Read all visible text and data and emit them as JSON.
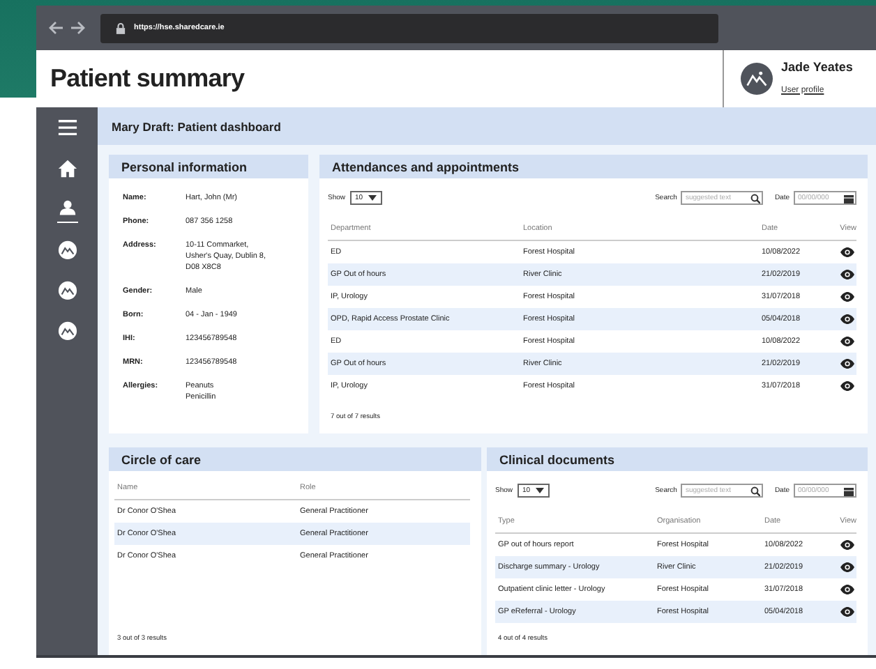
{
  "browser": {
    "url": "https://hse.sharedcare.ie"
  },
  "header": {
    "title": "Patient summary",
    "user": {
      "name": "Jade Yeates",
      "link": "User profile"
    }
  },
  "sidebar": {
    "items": [
      {
        "kind": "menu",
        "selected": false
      },
      {
        "kind": "home",
        "selected": false
      },
      {
        "kind": "person",
        "selected": true
      },
      {
        "kind": "avatar",
        "selected": false
      },
      {
        "kind": "avatar",
        "selected": false
      },
      {
        "kind": "avatar",
        "selected": false
      }
    ]
  },
  "dashboard": {
    "title": "Mary Draft: Patient dashboard"
  },
  "personal_information": {
    "title": "Personal information",
    "fields": [
      {
        "label": "Name:",
        "lines": [
          "Hart, John (Mr)"
        ]
      },
      {
        "label": "Phone:",
        "lines": [
          "087 356 1258"
        ]
      },
      {
        "label": "Address:",
        "lines": [
          "10-11 Commarket,",
          "Usher's Quay, Dublin 8,",
          "D08 X8C8"
        ]
      },
      {
        "label": "Gender:",
        "lines": [
          "Male"
        ]
      },
      {
        "label": "Born:",
        "lines": [
          "04 - Jan - 1949"
        ]
      },
      {
        "label": "IHI:",
        "lines": [
          "123456789548"
        ]
      },
      {
        "label": "MRN:",
        "lines": [
          "123456789548"
        ]
      },
      {
        "label": "Allergies:",
        "lines": [
          "Peanuts",
          "Penicillin"
        ]
      }
    ]
  },
  "attendances": {
    "title": "Attendances and appointments",
    "show": {
      "label": "Show",
      "value": "10"
    },
    "search": {
      "label": "Search",
      "placeholder": "suggested text"
    },
    "date": {
      "label": "Date",
      "placeholder": "00/00/000"
    },
    "columns": [
      "Department",
      "Location",
      "Date",
      "View"
    ],
    "rows": [
      [
        "ED",
        "Forest Hospital",
        "10/08/2022"
      ],
      [
        "GP Out of hours",
        "River Clinic",
        "21/02/2019"
      ],
      [
        "IP, Urology",
        "Forest Hospital",
        "31/07/2018"
      ],
      [
        "OPD, Rapid Access Prostate Clinic",
        "Forest Hospital",
        "05/04/2018"
      ],
      [
        "ED",
        "Forest Hospital",
        "10/08/2022"
      ],
      [
        "GP Out of hours",
        "River Clinic",
        "21/02/2019"
      ],
      [
        "IP, Urology",
        "Forest Hospital",
        "31/07/2018"
      ]
    ],
    "footer": "7 out of 7 results"
  },
  "circle_of_care": {
    "title": "Circle of care",
    "columns": [
      "Name",
      "Role"
    ],
    "rows": [
      [
        "Dr Conor O'Shea",
        "General Practitioner"
      ],
      [
        "Dr Conor O'Shea",
        "General Practitioner"
      ],
      [
        "Dr Conor O'Shea",
        "General Practitioner"
      ]
    ],
    "footer": "3 out of 3 results"
  },
  "clinical_documents": {
    "title": "Clinical documents",
    "show": {
      "label": "Show",
      "value": "10"
    },
    "search": {
      "label": "Search",
      "placeholder": "suggested text"
    },
    "date": {
      "label": "Date",
      "placeholder": "00/00/000"
    },
    "columns": [
      "Type",
      "Organisation",
      "Date",
      "View"
    ],
    "rows": [
      [
        "GP out of hours report",
        "Forest Hospital",
        "10/08/2022"
      ],
      [
        "Discharge summary - Urology",
        "River Clinic",
        "21/02/2019"
      ],
      [
        "Outpatient clinic letter - Urology",
        "Forest Hospital",
        "31/07/2018"
      ],
      [
        "GP eReferral - Urology",
        "Forest Hospital",
        "05/04/2018"
      ]
    ],
    "footer": "4 out of 4 results"
  }
}
